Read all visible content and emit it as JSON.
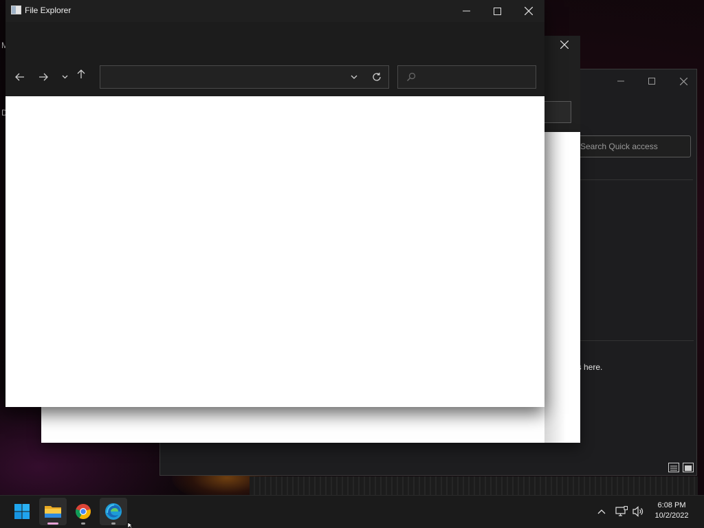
{
  "main_window": {
    "title": "File Explorer",
    "icons": {
      "app": "file-explorer-icon",
      "minimize": "minimize-icon",
      "maximize": "maximize-icon",
      "close": "close-icon",
      "back": "arrow-left-icon",
      "forward": "arrow-right-icon",
      "recent": "chevron-down-icon",
      "up": "arrow-up-icon",
      "address_dropdown": "chevron-down-icon",
      "refresh": "refresh-icon",
      "search": "search-icon"
    },
    "address_value": "",
    "search_value": ""
  },
  "middle_window": {
    "icons": {
      "close": "close-icon"
    }
  },
  "back_window": {
    "search_placeholder": "Search Quick access",
    "message_fragment": "es here.",
    "icons": {
      "minimize": "minimize-icon",
      "maximize": "maximize-icon",
      "close": "close-icon",
      "details_view": "details-view-icon",
      "tiles_view": "large-icons-view-icon"
    }
  },
  "desktop_edge": {
    "letter1": "M",
    "letter2": "D"
  },
  "taskbar": {
    "items": [
      {
        "name": "start",
        "icon": "windows-start-icon"
      },
      {
        "name": "file-explorer",
        "icon": "folder-icon",
        "active": true
      },
      {
        "name": "chrome",
        "icon": "chrome-icon"
      },
      {
        "name": "edge",
        "icon": "edge-icon"
      }
    ],
    "tray": {
      "icons": [
        "chevron-up-icon",
        "network-icon",
        "volume-icon"
      ],
      "time": "6:08 PM",
      "date": "10/2/2022"
    },
    "colors": {
      "active_indicator": "#e7a1d6",
      "inactive_indicator": "#9a9a9a"
    }
  }
}
